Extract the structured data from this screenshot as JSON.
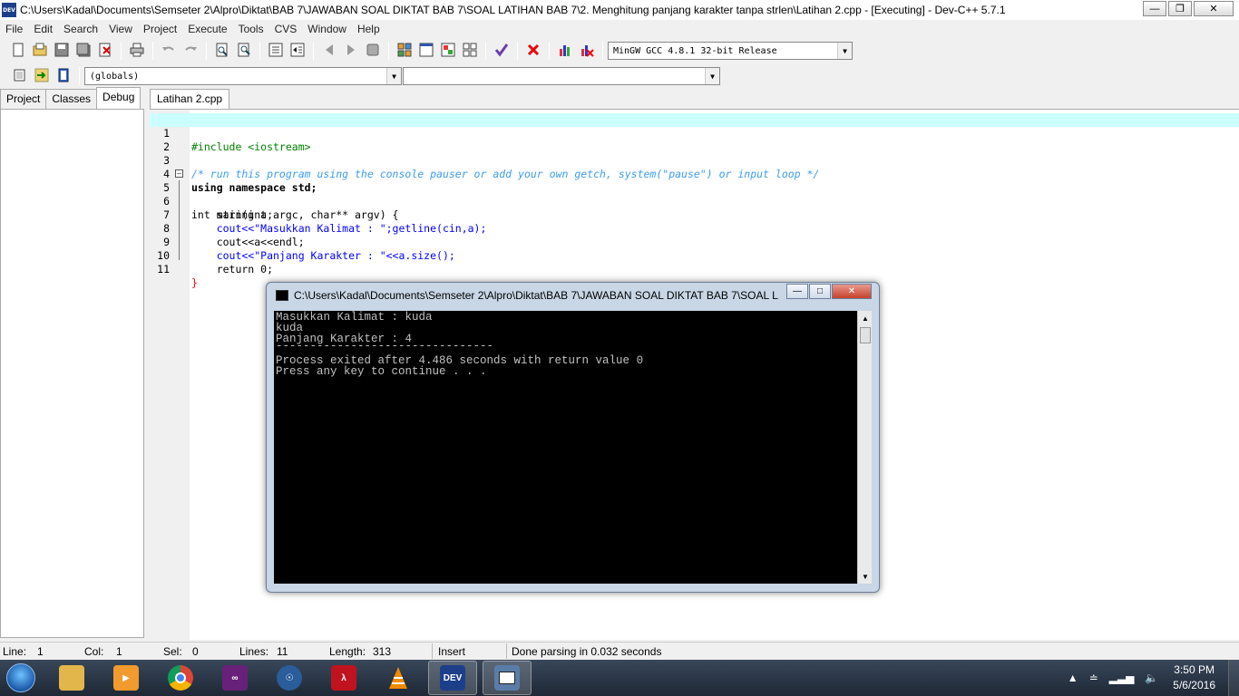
{
  "window": {
    "title": "C:\\Users\\Kadal\\Documents\\Semseter 2\\Alpro\\Diktat\\BAB 7\\JAWABAN SOAL DIKTAT BAB 7\\SOAL LATIHAN BAB 7\\2. Menghitung panjang karakter tanpa strlen\\Latihan 2.cpp - [Executing] - Dev-C++ 5.7.1",
    "app_icon_text": "DEV"
  },
  "menu": [
    "File",
    "Edit",
    "Search",
    "View",
    "Project",
    "Execute",
    "Tools",
    "CVS",
    "Window",
    "Help"
  ],
  "toolbar": {
    "compiler_select": "MinGW GCC 4.8.1 32-bit Release",
    "scope_select": "(globals)",
    "symbol_select": ""
  },
  "left_panel": {
    "tabs": [
      "Project",
      "Classes",
      "Debug"
    ],
    "active_tab": "Debug"
  },
  "editor": {
    "file_tab": "Latihan 2.cpp",
    "lines": [
      {
        "num": "1",
        "text": "#include <iostream>"
      },
      {
        "num": "2",
        "text": ""
      },
      {
        "num": "3",
        "text": "/* run this program using the console pauser or add your own getch, system(\"pause\") or input loop */"
      },
      {
        "num": "4",
        "text": "using namespace std;"
      },
      {
        "num": "5",
        "text": "int main(int argc, char** argv) {"
      },
      {
        "num": "6",
        "text": "    string a;"
      },
      {
        "num": "7",
        "text": "    cout<<\"Masukkan Kalimat : \";getline(cin,a);"
      },
      {
        "num": "8",
        "text": "    cout<<a<<endl;"
      },
      {
        "num": "9",
        "text": "    cout<<\"Panjang Karakter : \"<<a.size();"
      },
      {
        "num": "10",
        "text": "    return 0;"
      },
      {
        "num": "11",
        "text": "}"
      }
    ]
  },
  "status": {
    "line_label": "Line:",
    "line_value": "1",
    "col_label": "Col:",
    "col_value": "1",
    "sel_label": "Sel:",
    "sel_value": "0",
    "lines_label": "Lines:",
    "lines_value": "11",
    "length_label": "Length:",
    "length_value": "313",
    "mode": "Insert",
    "message": "Done parsing in 0.032 seconds"
  },
  "console": {
    "title": "C:\\Users\\Kadal\\Documents\\Semseter 2\\Alpro\\Diktat\\BAB 7\\JAWABAN SOAL DIKTAT BAB 7\\SOAL L...",
    "lines": [
      "Masukkan Kalimat : kuda",
      "kuda",
      "Panjang Karakter : 4",
      "--------------------------------",
      "Process exited after 4.486 seconds with return value 0",
      "Press any key to continue . . ."
    ]
  },
  "taskbar": {
    "apps": [
      {
        "name": "explorer",
        "color": "#e2b64a"
      },
      {
        "name": "media-player",
        "color": "#f29a2e"
      },
      {
        "name": "chrome",
        "color": "#db4437"
      },
      {
        "name": "visual-studio",
        "color": "#68217a"
      },
      {
        "name": "network-globe",
        "color": "#2a5d9a"
      },
      {
        "name": "pdf-reader",
        "color": "#c1121f"
      },
      {
        "name": "vlc",
        "color": "#f08a00"
      },
      {
        "name": "devcpp",
        "color": "#1d3f8a"
      },
      {
        "name": "console",
        "color": "#5a7da8"
      }
    ],
    "devcpp_label": "DEV",
    "time": "3:50 PM",
    "date": "5/6/2016"
  }
}
